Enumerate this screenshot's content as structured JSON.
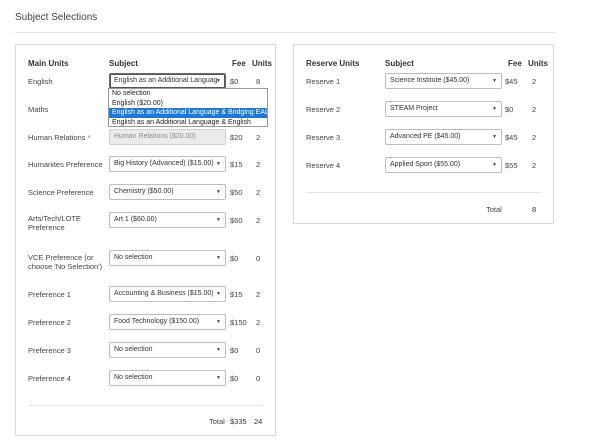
{
  "page_title": "Subject Selections",
  "main": {
    "headers": {
      "units_label": "Main Units",
      "subject": "Subject",
      "fee": "Fee",
      "units": "Units"
    },
    "rows": [
      {
        "label": "English",
        "required": false,
        "value": "English as an Additional Language & Bridging EAL",
        "fee": "$0",
        "units": "8",
        "disabled": false
      },
      {
        "label": "Maths",
        "required": false,
        "value": "",
        "fee": "",
        "units": "",
        "disabled": false
      },
      {
        "label": "Human Relations",
        "required": true,
        "value": "Human Relations ($20.00)",
        "fee": "$20",
        "units": "2",
        "disabled": true
      },
      {
        "label": "Humanites Preference",
        "required": false,
        "value": "Big History (Advanced) ($15.00)",
        "fee": "$15",
        "units": "2",
        "disabled": false
      },
      {
        "label": "Science Preference",
        "required": false,
        "value": "Chemistry ($50.00)",
        "fee": "$50",
        "units": "2",
        "disabled": false
      },
      {
        "label": "Arts/Tech/LOTE Preference",
        "required": false,
        "value": "Art 1 ($60.00)",
        "fee": "$60",
        "units": "2",
        "disabled": false
      },
      {
        "label": "VCE Preference (or choose 'No Selection')",
        "required": false,
        "value": "No selection",
        "fee": "$0",
        "units": "0",
        "disabled": false
      },
      {
        "label": "Preference 1",
        "required": false,
        "value": "Accounting & Business ($15.00)",
        "fee": "$15",
        "units": "2",
        "disabled": false
      },
      {
        "label": "Preference 2",
        "required": false,
        "value": "Food Technology ($150.00)",
        "fee": "$150",
        "units": "2",
        "disabled": false
      },
      {
        "label": "Preference 3",
        "required": false,
        "value": "No selection",
        "fee": "$0",
        "units": "0",
        "disabled": false
      },
      {
        "label": "Preference 4",
        "required": false,
        "value": "No selection",
        "fee": "$0",
        "units": "0",
        "disabled": false
      }
    ],
    "required_mark": "*",
    "total_label": "Total",
    "total_fee": "$335",
    "total_units": "24"
  },
  "english_dropdown": {
    "options": [
      "No selection",
      "English ($20.00)",
      "English as an Additional Language & Bridging EAL",
      "English as an Additional Language & English"
    ],
    "highlighted_index": 2
  },
  "reserve": {
    "headers": {
      "units_label": "Reserve Units",
      "subject": "Subject",
      "fee": "Fee",
      "units": "Units"
    },
    "rows": [
      {
        "label": "Reserve 1",
        "value": "Science Institute ($45.00)",
        "fee": "$45",
        "units": "2"
      },
      {
        "label": "Reserve 2",
        "value": "STEAM Project",
        "fee": "$0",
        "units": "2"
      },
      {
        "label": "Reserve 3",
        "value": "Advanced PE ($45.00)",
        "fee": "$45",
        "units": "2"
      },
      {
        "label": "Reserve 4",
        "value": "Applied Sport ($55.00)",
        "fee": "$55",
        "units": "2"
      }
    ],
    "total_label": "Total",
    "total_units": "8"
  },
  "icons": {
    "select_caret": "caret-down-icon",
    "caret_glyph": "▼"
  }
}
